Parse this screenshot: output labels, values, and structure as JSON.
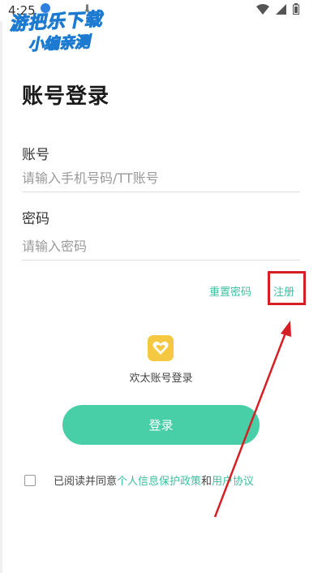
{
  "status_bar": {
    "time": "4:25",
    "icons": [
      "download-icon",
      "download-icon",
      "wifi-icon",
      "signal-icon",
      "battery-icon"
    ]
  },
  "watermark": {
    "line1": "游把乐下载",
    "line2": "小编亲测"
  },
  "page": {
    "title": "账号登录"
  },
  "account": {
    "label": "账号",
    "placeholder": "请输入手机号码/TT账号"
  },
  "password": {
    "label": "密码",
    "placeholder": "请输入密码"
  },
  "links": {
    "reset_password": "重置密码",
    "register": "注册"
  },
  "alt_login": {
    "icon": "heart-icon",
    "caption": "欢太账号登录",
    "icon_color": "#f5c842"
  },
  "login_button": {
    "label": "登录",
    "color": "#48cfa8"
  },
  "agreement": {
    "prefix": "已阅读并同意",
    "privacy_link": "个人信息保护政策",
    "conj": "和",
    "terms_link": "用户协议"
  },
  "accent_color": "#3fbfa0",
  "annotation_color": "#d61f24"
}
